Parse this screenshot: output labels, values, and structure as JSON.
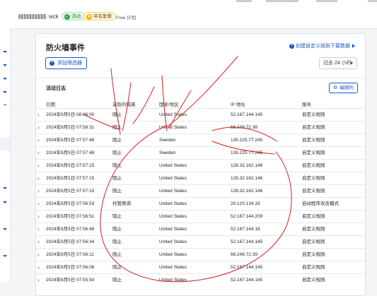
{
  "header": {
    "domain_suffix": "wck",
    "active_badge": "活动",
    "plan_badge": "带有套餐",
    "plan_label": "Free 计划"
  },
  "card": {
    "title": "防火墙事件",
    "create_rule_label": "创建自定义规则",
    "download_label": "下载数据",
    "add_filter_label": "添加筛选器",
    "time_range": "过去 24 小时",
    "log_title": "活动日志",
    "edit_columns_label": "编辑列"
  },
  "table": {
    "columns": [
      "日期",
      "采取的措施",
      "国家/地区",
      "IP 地址",
      "服务"
    ],
    "rows": [
      {
        "date": "2024年9月5日 08:06:00",
        "action": "阻止",
        "country": "United States",
        "ip": "52.167.144.145",
        "service": "自定义规则"
      },
      {
        "date": "2024年9月5日 07:58:31",
        "action": "阻止",
        "country": "United States",
        "ip": "66.249.72.38",
        "service": "自定义规则"
      },
      {
        "date": "2024年9月5日 07:57:48",
        "action": "阻止",
        "country": "Sweden",
        "ip": "135.225.77.245",
        "service": "自定义规则"
      },
      {
        "date": "2024年9月5日 07:57:48",
        "action": "阻止",
        "country": "Sweden",
        "ip": "135.225.77.245",
        "service": "自定义规则"
      },
      {
        "date": "2024年9月5日 07:57:15",
        "action": "阻止",
        "country": "United States",
        "ip": "128.32.162.146",
        "service": "自定义规则"
      },
      {
        "date": "2024年9月5日 07:57:15",
        "action": "阻止",
        "country": "United States",
        "ip": "128.32.162.146",
        "service": "自定义规则"
      },
      {
        "date": "2024年9月5日 07:57:15",
        "action": "阻止",
        "country": "United States",
        "ip": "128.32.162.146",
        "service": "自定义规则"
      },
      {
        "date": "2024年9月5日 07:56:53",
        "action": "托管质询",
        "country": "United States",
        "ip": "20.120.134.33",
        "service": "自动程序攻击模式"
      },
      {
        "date": "2024年9月5日 07:56:51",
        "action": "阻止",
        "country": "United States",
        "ip": "52.167.144.209",
        "service": "自定义规则"
      },
      {
        "date": "2024年9月5日 07:56:48",
        "action": "阻止",
        "country": "United States",
        "ip": "52.167.144.18",
        "service": "自定义规则"
      },
      {
        "date": "2024年9月5日 07:56:34",
        "action": "阻止",
        "country": "United States",
        "ip": "52.167.144.145",
        "service": "自定义规则"
      },
      {
        "date": "2024年9月5日 07:56:11",
        "action": "阻止",
        "country": "United States",
        "ip": "66.249.72.39",
        "service": "自定义规则"
      },
      {
        "date": "2024年9月5日 07:56:06",
        "action": "阻止",
        "country": "United States",
        "ip": "52.167.144.145",
        "service": "自定义规则"
      },
      {
        "date": "2024年9月5日 07:55:54",
        "action": "阻止",
        "country": "United States",
        "ip": "52.167.144.145",
        "service": "自定义规则"
      }
    ]
  },
  "colors": {
    "accent": "#1a56c9",
    "annotation": "#d42020"
  }
}
